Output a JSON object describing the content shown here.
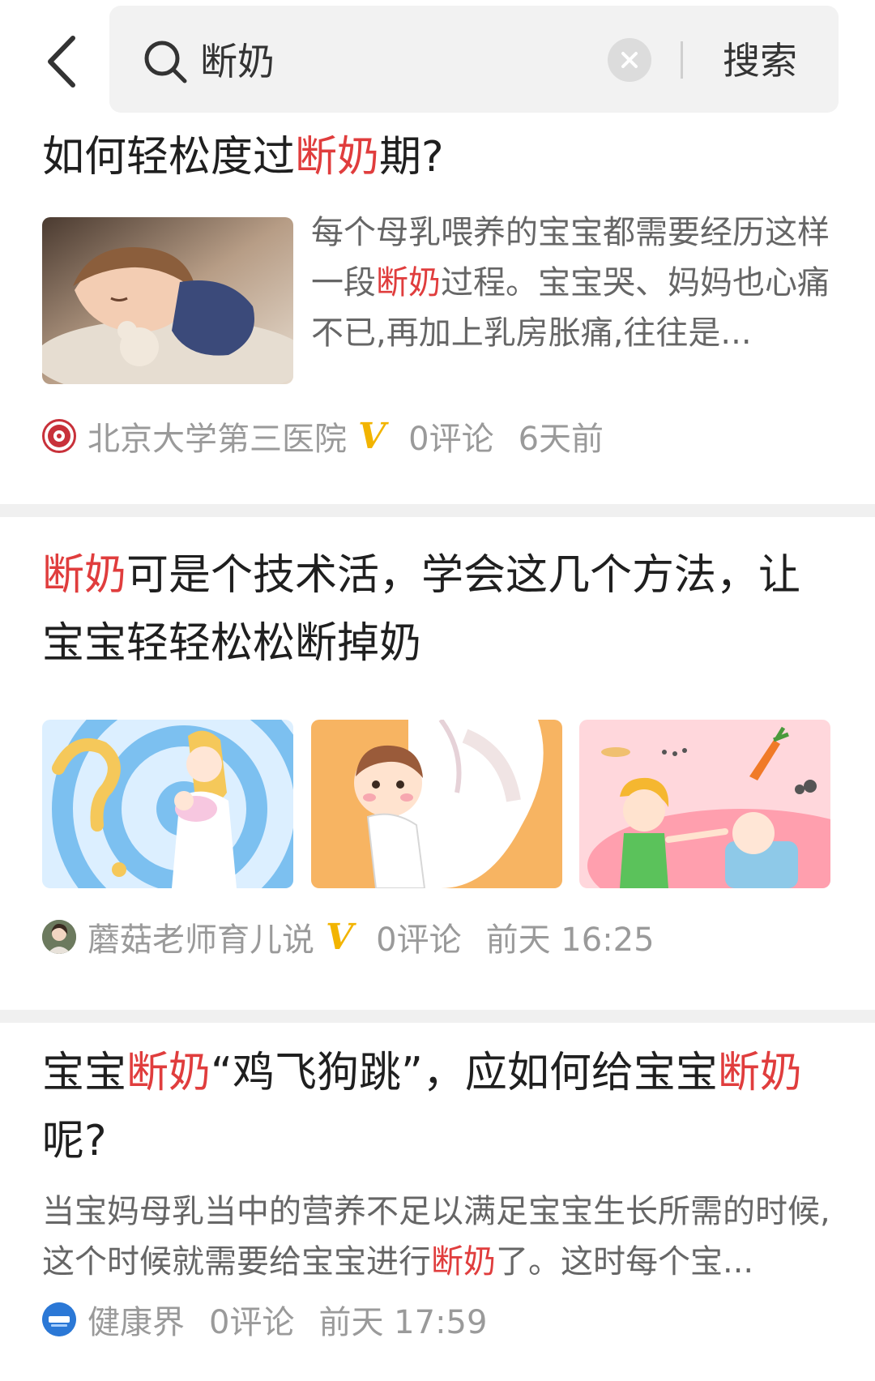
{
  "search": {
    "query": "断奶",
    "button_label": "搜索"
  },
  "icons": {
    "back": "chevron-left-icon",
    "search": "search-icon",
    "clear": "close-circle-icon",
    "verified": "verified-v-icon"
  },
  "colors": {
    "highlight": "#e03d3d",
    "verified": "#f2b400",
    "meta_text": "#9a9a9a",
    "title_text": "#1f1f1f",
    "search_bg": "#f2f2f2"
  },
  "articles": [
    {
      "title_parts": [
        "如何轻松度过",
        "断奶",
        "期?"
      ],
      "summary_parts": [
        "每个母乳喂养的宝宝都需要经历这样一段",
        "断奶",
        "过程。宝宝哭、妈妈也心痛不已,再加上乳房胀痛,往往是..."
      ],
      "source": "北京大学第三医院",
      "verified": "V",
      "comments": "0评论",
      "time": "6天前"
    },
    {
      "title_parts": [
        "断奶",
        "可是个技术活，学会这几个方法，让宝宝轻轻松松断掉奶"
      ],
      "source": "蘑菇老师育儿说",
      "verified": "V",
      "comments": "0评论",
      "time": "前天 16:25"
    },
    {
      "title_parts": [
        "宝宝",
        "断奶",
        "“鸡飞狗跳”，应如何给宝宝",
        "断奶",
        "呢?"
      ],
      "summary_parts": [
        "当宝妈母乳当中的营养不足以满足宝宝生长所需的时候,这个时候就需要给宝宝进行",
        "断奶",
        "了。这时每个宝..."
      ],
      "source": "健康界",
      "comments": "0评论",
      "time": "前天 17:59"
    }
  ]
}
